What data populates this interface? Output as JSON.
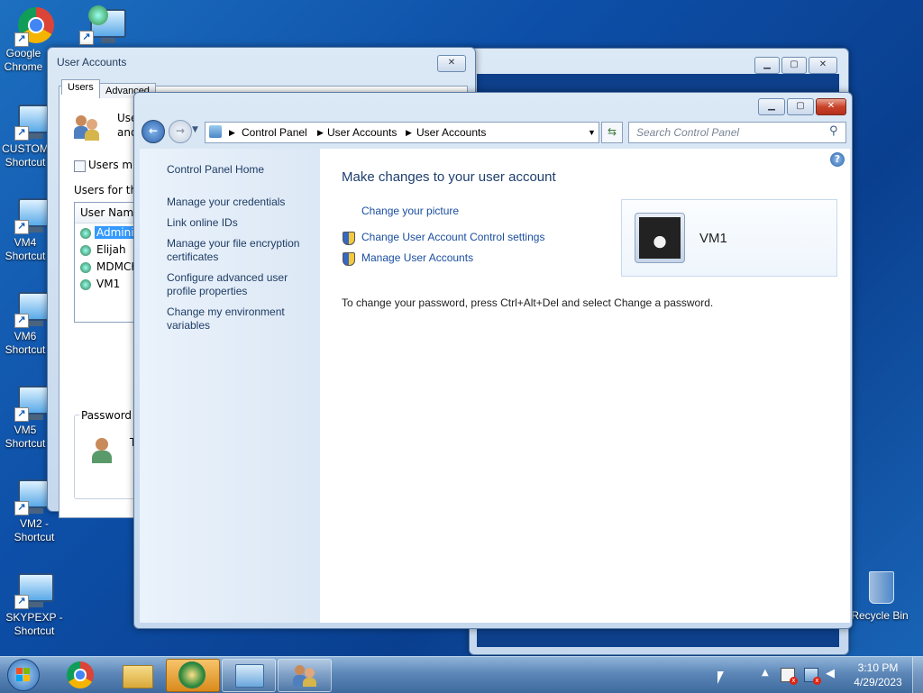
{
  "desktop": {
    "icons": [
      {
        "label": "Google Chrome"
      },
      {
        "label": "CUSTOM Shortcut"
      },
      {
        "label": "VM4 Shortcut"
      },
      {
        "label": "VM6 Shortcut"
      },
      {
        "label": "VM5 Shortcut"
      },
      {
        "label": "VM2 - Shortcut"
      },
      {
        "label": "SKYPEXP - Shortcut"
      }
    ],
    "recycle_bin": "Recycle Bin"
  },
  "user_accounts_dialog": {
    "title": "User Accounts",
    "tabs": [
      "Users",
      "Advanced"
    ],
    "intro_line1": "Use",
    "intro_line2": "and",
    "checkbox_label": "Users mus",
    "users_for_label": "Users for this",
    "column_user_name": "User Name",
    "users": [
      "Adminis",
      "Elijah",
      "MDMCK",
      "VM1"
    ],
    "password_group": "Password f",
    "password_text": "T"
  },
  "control_panel": {
    "breadcrumb": [
      "Control Panel",
      "User Accounts",
      "User Accounts"
    ],
    "search_placeholder": "Search Control Panel",
    "nav": {
      "home": "Control Panel Home",
      "links": [
        "Manage your credentials",
        "Link online IDs",
        "Manage your file encryption certificates",
        "Configure advanced user profile properties",
        "Change my environment variables"
      ]
    },
    "heading": "Make changes to your user account",
    "tasks": {
      "change_picture": "Change your picture",
      "uac_settings": "Change User Account Control settings",
      "manage_accounts": "Manage User Accounts"
    },
    "account_name": "VM1",
    "password_note": "To change your password, press Ctrl+Alt+Del and select Change a password."
  },
  "taskbar": {
    "time": "3:10 PM",
    "date": "4/29/2023"
  }
}
